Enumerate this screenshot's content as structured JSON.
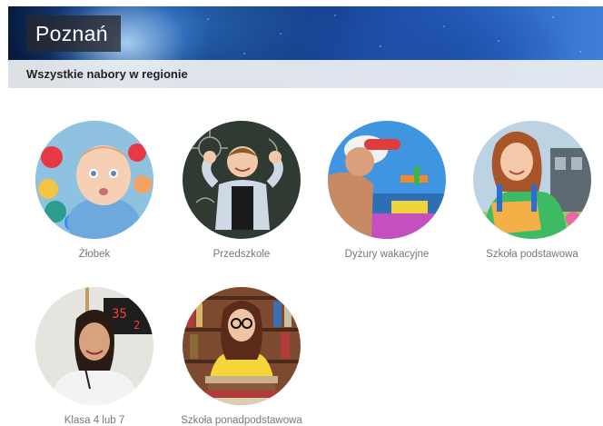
{
  "header": {
    "title": "Poznań",
    "subtitle": "Wszystkie nabory w regionie"
  },
  "tiles": [
    {
      "label": "Żłobek",
      "icon": "toddler-photo"
    },
    {
      "label": "Przedszkole",
      "icon": "preschool-boy-photo"
    },
    {
      "label": "Dyżury wakacyjne",
      "icon": "summer-child-photo"
    },
    {
      "label": "Szkoła podstawowa",
      "icon": "schoolgirl-photo"
    },
    {
      "label": "Klasa 4 lub 7",
      "icon": "teacher-photo"
    },
    {
      "label": "Szkoła ponadpodstawowa",
      "icon": "student-books-photo"
    }
  ]
}
